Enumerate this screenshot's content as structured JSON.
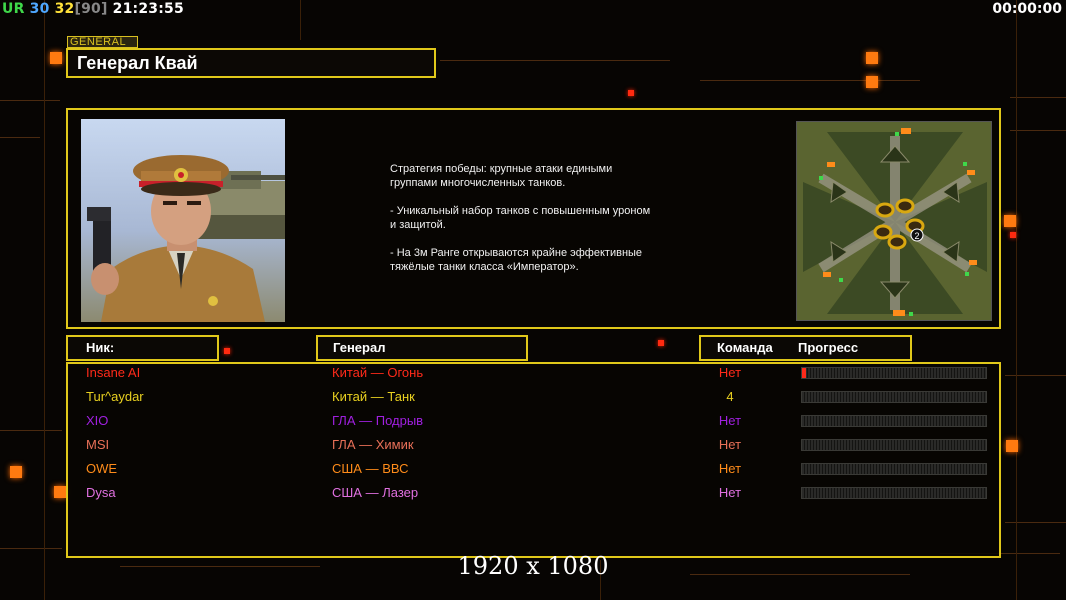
{
  "hud": {
    "ur": "UR",
    "val1": "30",
    "val2": "32",
    "val3": "[90]",
    "clock": "21:23:55",
    "timer": "00:00:00"
  },
  "general": {
    "tag": "GENERAL",
    "name": "Генерал Квай",
    "description": "Стратегия победы: крупные атаки едиными\n группами многочисленных танков.\n\n- Уникальный набор танков с повышенным уроном\n и защитой.\n\n- На 3м Ранге открываются крайне эффективные\n тяжёлые танки класса «Император»."
  },
  "minimap": {
    "marker": "2"
  },
  "table": {
    "nick_header": "Ник:",
    "general_header": "Генерал",
    "team_header": "Команда",
    "progress_header": "Прогресс",
    "rows": [
      {
        "nick": "Insane AI",
        "general": "Китай — Огонь",
        "team": "Нет",
        "color": "#ff2a1a",
        "progress": 0.02
      },
      {
        "nick": "Tur^aydar",
        "general": "Китай — Танк",
        "team": "4",
        "color": "#e8d020",
        "progress": 0
      },
      {
        "nick": "XIO",
        "general": "ГЛА — Подрыв",
        "team": "Нет",
        "color": "#a020e0",
        "progress": 0
      },
      {
        "nick": "MSI",
        "general": "ГЛА — Химик",
        "team": "Нет",
        "color": "#e87058",
        "progress": 0
      },
      {
        "nick": "OWE",
        "general": "США — ВВС",
        "team": "Нет",
        "color": "#ff8c1a",
        "progress": 0
      },
      {
        "nick": "Dysa",
        "general": "США — Лазер",
        "team": "Нет",
        "color": "#e070e0",
        "progress": 0
      }
    ]
  },
  "resolution_label": "1920 x 1080"
}
